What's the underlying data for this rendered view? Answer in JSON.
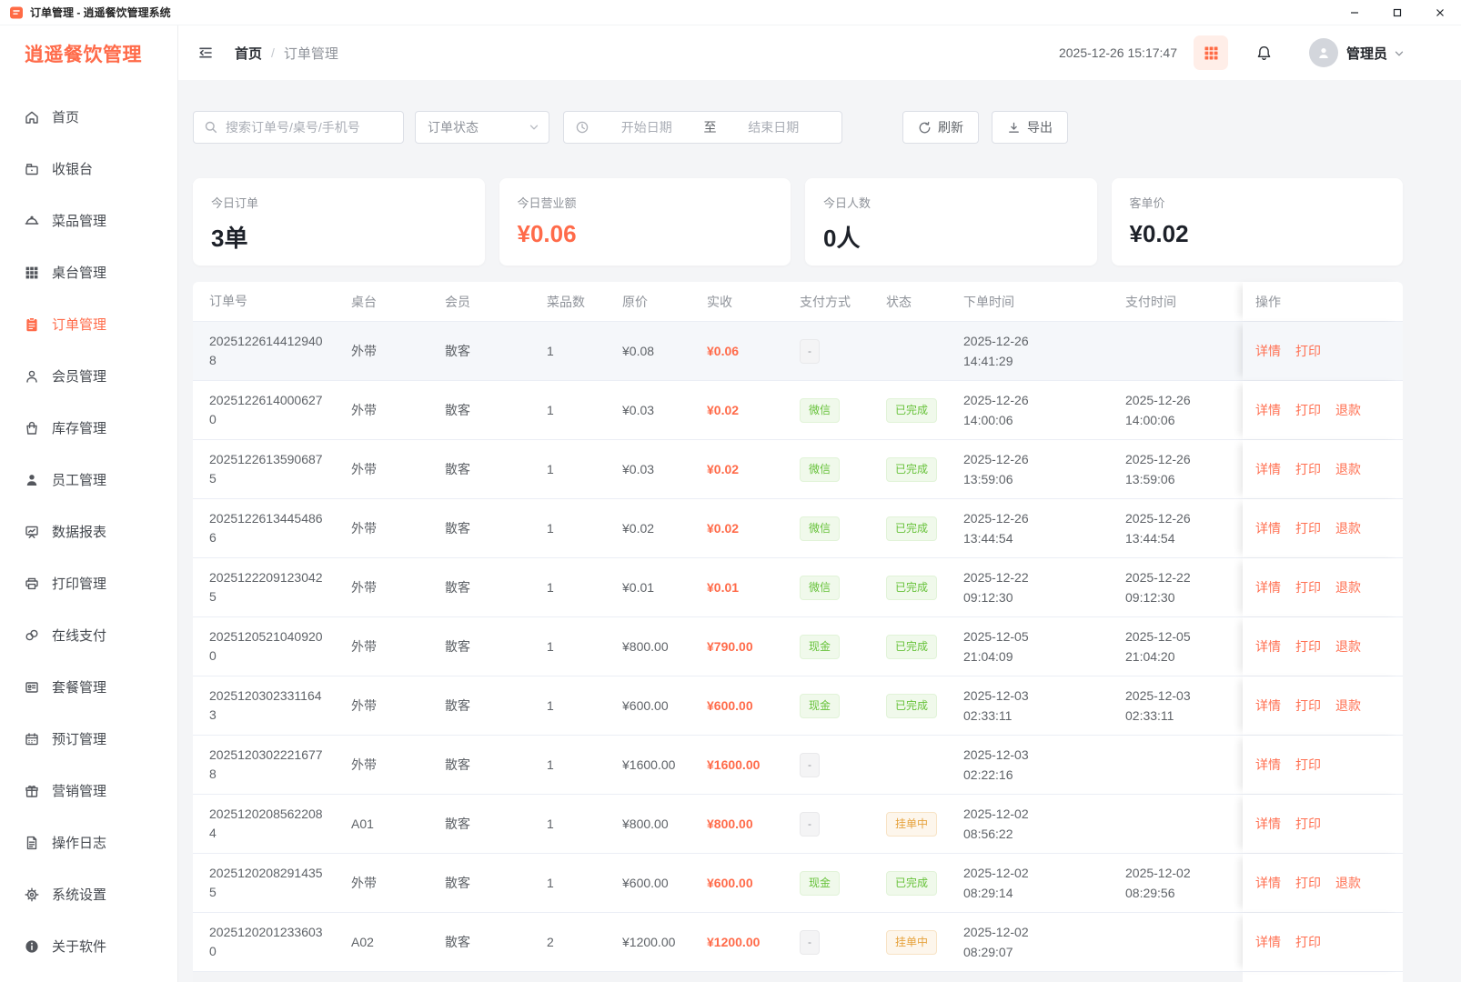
{
  "window": {
    "title": "订单管理 - 逍遥餐饮管理系统"
  },
  "colors": {
    "brand": "#ff6b4a",
    "success": "#67c23a",
    "warning": "#e6a23c",
    "info": "#909399"
  },
  "sidebar": {
    "logo": "逍遥餐饮管理",
    "items": [
      {
        "id": "home",
        "label": "首页",
        "icon": "home-icon",
        "active": false
      },
      {
        "id": "cashier",
        "label": "收银台",
        "icon": "cashier-icon",
        "active": false
      },
      {
        "id": "dishes",
        "label": "菜品管理",
        "icon": "dish-icon",
        "active": false
      },
      {
        "id": "tables",
        "label": "桌台管理",
        "icon": "table-grid-icon",
        "active": false
      },
      {
        "id": "orders",
        "label": "订单管理",
        "icon": "order-icon",
        "active": true
      },
      {
        "id": "members",
        "label": "会员管理",
        "icon": "member-icon",
        "active": false
      },
      {
        "id": "inventory",
        "label": "库存管理",
        "icon": "inventory-icon",
        "active": false
      },
      {
        "id": "staff",
        "label": "员工管理",
        "icon": "staff-icon",
        "active": false
      },
      {
        "id": "reports",
        "label": "数据报表",
        "icon": "report-icon",
        "active": false
      },
      {
        "id": "printing",
        "label": "打印管理",
        "icon": "printer-icon",
        "active": false
      },
      {
        "id": "online-payment",
        "label": "在线支付",
        "icon": "payment-icon",
        "active": false
      },
      {
        "id": "packages",
        "label": "套餐管理",
        "icon": "package-icon",
        "active": false
      },
      {
        "id": "reservations",
        "label": "预订管理",
        "icon": "reservation-icon",
        "active": false
      },
      {
        "id": "marketing",
        "label": "营销管理",
        "icon": "marketing-icon",
        "active": false
      },
      {
        "id": "logs",
        "label": "操作日志",
        "icon": "log-icon",
        "active": false
      },
      {
        "id": "settings",
        "label": "系统设置",
        "icon": "settings-icon",
        "active": false
      },
      {
        "id": "about",
        "label": "关于软件",
        "icon": "about-icon",
        "active": false
      }
    ]
  },
  "header": {
    "breadcrumb_home": "首页",
    "breadcrumb_sep": "/",
    "breadcrumb_current": "订单管理",
    "datetime": "2025-12-26 15:17:47",
    "username": "管理员"
  },
  "filters": {
    "search_placeholder": "搜索订单号/桌号/手机号",
    "status_placeholder": "订单状态",
    "date_start_placeholder": "开始日期",
    "date_separator": "至",
    "date_end_placeholder": "结束日期",
    "refresh_label": "刷新",
    "export_label": "导出"
  },
  "stats": [
    {
      "label": "今日订单",
      "value": "3单",
      "accent": false
    },
    {
      "label": "今日营业额",
      "value": "¥0.06",
      "accent": true
    },
    {
      "label": "今日人数",
      "value": "0人",
      "accent": false
    },
    {
      "label": "客单价",
      "value": "¥0.02",
      "accent": false
    }
  ],
  "table": {
    "columns": [
      {
        "key": "no",
        "label": "订单号"
      },
      {
        "key": "table",
        "label": "桌台"
      },
      {
        "key": "member",
        "label": "会员"
      },
      {
        "key": "count",
        "label": "菜品数"
      },
      {
        "key": "orig",
        "label": "原价"
      },
      {
        "key": "real",
        "label": "实收"
      },
      {
        "key": "pay",
        "label": "支付方式"
      },
      {
        "key": "status",
        "label": "状态"
      },
      {
        "key": "otime",
        "label": "下单时间"
      },
      {
        "key": "ptime",
        "label": "支付时间"
      },
      {
        "key": "actions",
        "label": "操作"
      }
    ],
    "rows": [
      {
        "no": "20251226144129408",
        "table": "外带",
        "member": "散客",
        "count": "1",
        "orig": "¥0.08",
        "real": "¥0.06",
        "pay": {
          "label": "-",
          "type": "info"
        },
        "status": null,
        "order_time": "2025-12-26 14:41:29",
        "pay_time": "",
        "highlight": true,
        "actions": [
          {
            "name": "detail",
            "label": "详情"
          },
          {
            "name": "print",
            "label": "打印"
          }
        ]
      },
      {
        "no": "20251226140006270",
        "table": "外带",
        "member": "散客",
        "count": "1",
        "orig": "¥0.03",
        "real": "¥0.02",
        "pay": {
          "label": "微信",
          "type": "success"
        },
        "status": {
          "label": "已完成",
          "type": "success"
        },
        "order_time": "2025-12-26 14:00:06",
        "pay_time": "2025-12-26 14:00:06",
        "highlight": false,
        "actions": [
          {
            "name": "detail",
            "label": "详情"
          },
          {
            "name": "print",
            "label": "打印"
          },
          {
            "name": "refund",
            "label": "退款"
          }
        ]
      },
      {
        "no": "20251226135906875",
        "table": "外带",
        "member": "散客",
        "count": "1",
        "orig": "¥0.03",
        "real": "¥0.02",
        "pay": {
          "label": "微信",
          "type": "success"
        },
        "status": {
          "label": "已完成",
          "type": "success"
        },
        "order_time": "2025-12-26 13:59:06",
        "pay_time": "2025-12-26 13:59:06",
        "highlight": false,
        "actions": [
          {
            "name": "detail",
            "label": "详情"
          },
          {
            "name": "print",
            "label": "打印"
          },
          {
            "name": "refund",
            "label": "退款"
          }
        ]
      },
      {
        "no": "20251226134454866",
        "table": "外带",
        "member": "散客",
        "count": "1",
        "orig": "¥0.02",
        "real": "¥0.02",
        "pay": {
          "label": "微信",
          "type": "success"
        },
        "status": {
          "label": "已完成",
          "type": "success"
        },
        "order_time": "2025-12-26 13:44:54",
        "pay_time": "2025-12-26 13:44:54",
        "highlight": false,
        "actions": [
          {
            "name": "detail",
            "label": "详情"
          },
          {
            "name": "print",
            "label": "打印"
          },
          {
            "name": "refund",
            "label": "退款"
          }
        ]
      },
      {
        "no": "20251222091230425",
        "table": "外带",
        "member": "散客",
        "count": "1",
        "orig": "¥0.01",
        "real": "¥0.01",
        "pay": {
          "label": "微信",
          "type": "success"
        },
        "status": {
          "label": "已完成",
          "type": "success"
        },
        "order_time": "2025-12-22 09:12:30",
        "pay_time": "2025-12-22 09:12:30",
        "highlight": false,
        "actions": [
          {
            "name": "detail",
            "label": "详情"
          },
          {
            "name": "print",
            "label": "打印"
          },
          {
            "name": "refund",
            "label": "退款"
          }
        ]
      },
      {
        "no": "20251205210409200",
        "table": "外带",
        "member": "散客",
        "count": "1",
        "orig": "¥800.00",
        "real": "¥790.00",
        "pay": {
          "label": "现金",
          "type": "success"
        },
        "status": {
          "label": "已完成",
          "type": "success"
        },
        "order_time": "2025-12-05 21:04:09",
        "pay_time": "2025-12-05 21:04:20",
        "highlight": false,
        "actions": [
          {
            "name": "detail",
            "label": "详情"
          },
          {
            "name": "print",
            "label": "打印"
          },
          {
            "name": "refund",
            "label": "退款"
          }
        ]
      },
      {
        "no": "20251203023311643",
        "table": "外带",
        "member": "散客",
        "count": "1",
        "orig": "¥600.00",
        "real": "¥600.00",
        "pay": {
          "label": "现金",
          "type": "success"
        },
        "status": {
          "label": "已完成",
          "type": "success"
        },
        "order_time": "2025-12-03 02:33:11",
        "pay_time": "2025-12-03 02:33:11",
        "highlight": false,
        "actions": [
          {
            "name": "detail",
            "label": "详情"
          },
          {
            "name": "print",
            "label": "打印"
          },
          {
            "name": "refund",
            "label": "退款"
          }
        ]
      },
      {
        "no": "20251203022216778",
        "table": "外带",
        "member": "散客",
        "count": "1",
        "orig": "¥1600.00",
        "real": "¥1600.00",
        "pay": {
          "label": "-",
          "type": "info"
        },
        "status": null,
        "order_time": "2025-12-03 02:22:16",
        "pay_time": "",
        "highlight": false,
        "actions": [
          {
            "name": "detail",
            "label": "详情"
          },
          {
            "name": "print",
            "label": "打印"
          }
        ]
      },
      {
        "no": "20251202085622084",
        "table": "A01",
        "member": "散客",
        "count": "1",
        "orig": "¥800.00",
        "real": "¥800.00",
        "pay": {
          "label": "-",
          "type": "info"
        },
        "status": {
          "label": "挂单中",
          "type": "warning"
        },
        "order_time": "2025-12-02 08:56:22",
        "pay_time": "",
        "highlight": false,
        "actions": [
          {
            "name": "detail",
            "label": "详情"
          },
          {
            "name": "print",
            "label": "打印"
          }
        ]
      },
      {
        "no": "20251202082914355",
        "table": "外带",
        "member": "散客",
        "count": "1",
        "orig": "¥600.00",
        "real": "¥600.00",
        "pay": {
          "label": "现金",
          "type": "success"
        },
        "status": {
          "label": "已完成",
          "type": "success"
        },
        "order_time": "2025-12-02 08:29:14",
        "pay_time": "2025-12-02 08:29:56",
        "highlight": false,
        "actions": [
          {
            "name": "detail",
            "label": "详情"
          },
          {
            "name": "print",
            "label": "打印"
          },
          {
            "name": "refund",
            "label": "退款"
          }
        ]
      },
      {
        "no": "20251202012336030",
        "table": "A02",
        "member": "散客",
        "count": "2",
        "orig": "¥1200.00",
        "real": "¥1200.00",
        "pay": {
          "label": "-",
          "type": "info"
        },
        "status": {
          "label": "挂单中",
          "type": "warning"
        },
        "order_time": "2025-12-02 08:29:07",
        "pay_time": "",
        "highlight": false,
        "actions": [
          {
            "name": "detail",
            "label": "详情"
          },
          {
            "name": "print",
            "label": "打印"
          }
        ]
      }
    ]
  }
}
